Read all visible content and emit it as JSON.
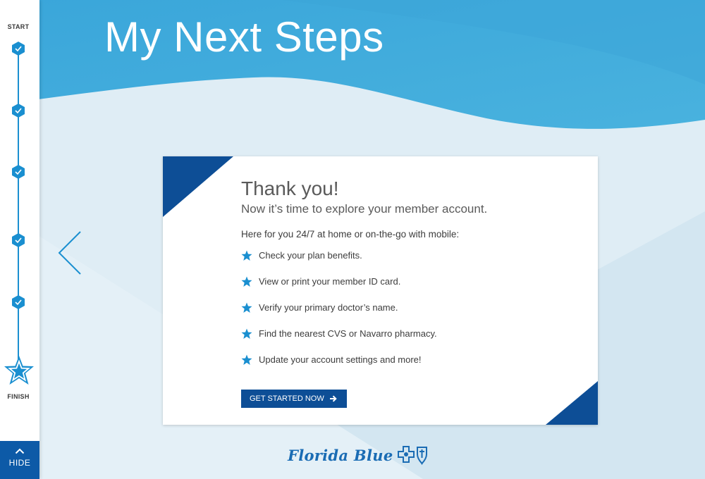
{
  "page": {
    "title": "My Next Steps"
  },
  "progress": {
    "start_label": "START",
    "finish_label": "FINISH",
    "completed_steps": 5,
    "hide_label": "HIDE"
  },
  "card": {
    "heading": "Thank you!",
    "subheading": "Now it’s time to explore your member account.",
    "intro": "Here for you 24/7 at home or on-the-go with mobile:",
    "items": [
      "Check your plan benefits.",
      "View or print your member ID card.",
      "Verify your primary doctor’s name.",
      "Find the nearest CVS or Navarro pharmacy.",
      "Update your account settings and more!"
    ],
    "cta_label": "GET STARTED NOW"
  },
  "brand": {
    "name": "Florida Blue"
  },
  "colors": {
    "accent": "#1a8fd0",
    "navy": "#0d4e96",
    "header_blue": "#3aa8d9"
  }
}
